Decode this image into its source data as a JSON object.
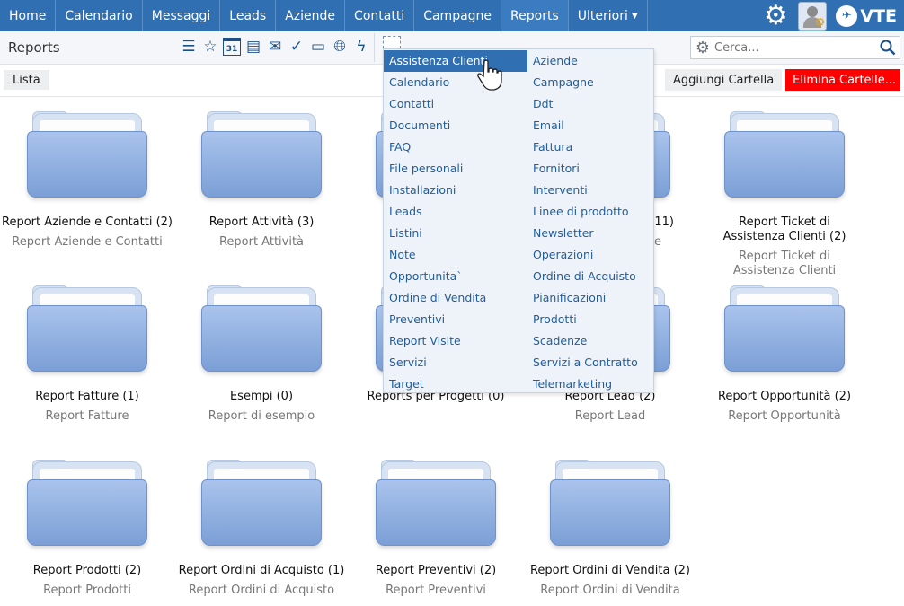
{
  "topnav": {
    "items": [
      {
        "label": "Home"
      },
      {
        "label": "Calendario"
      },
      {
        "label": "Messaggi"
      },
      {
        "label": "Leads"
      },
      {
        "label": "Aziende"
      },
      {
        "label": "Contatti"
      },
      {
        "label": "Campagne"
      },
      {
        "label": "Reports"
      },
      {
        "label": "Ulteriori"
      }
    ],
    "active": "Reports",
    "logo_text": "VTE"
  },
  "subbar": {
    "title": "Reports",
    "toolbar_icons": [
      "list-icon",
      "star-icon",
      "calendar-icon",
      "notes-icon",
      "mail-icon",
      "check-icon",
      "chat-icon",
      "globe-icon",
      "flash-icon"
    ],
    "calendar_day": "31",
    "search_placeholder": "Cerca..."
  },
  "actions": {
    "lista": "Lista",
    "add_folder": "Aggiungi Cartella",
    "delete_folders": "Elimina Cartelle..."
  },
  "folders": [
    {
      "title": "Report Aziende e Contatti (2)",
      "desc": "Report Aziende e Contatti"
    },
    {
      "title": "Report Attività (3)",
      "desc": "Report Attività"
    },
    {
      "title": "",
      "desc": ""
    },
    {
      "title": "(11)",
      "desc": "e"
    },
    {
      "title": "Report Ticket di Assistenza Clienti (2)",
      "desc": "Report Ticket di Assistenza Clienti"
    },
    {
      "title": "Report Fatture (1)",
      "desc": "Report Fatture"
    },
    {
      "title": "Esempi (0)",
      "desc": "Report di esempio"
    },
    {
      "title": "Reports per Progetti (0)",
      "desc": ""
    },
    {
      "title": "Report Lead (2)",
      "desc": "Report Lead"
    },
    {
      "title": "Report Opportunità (2)",
      "desc": "Report Opportunità"
    },
    {
      "title": "Report Prodotti (2)",
      "desc": "Report Prodotti"
    },
    {
      "title": "Report Ordini di Acquisto (1)",
      "desc": "Report Ordini di Acquisto"
    },
    {
      "title": "Report Preventivi (2)",
      "desc": "Report Preventivi"
    },
    {
      "title": "Report Ordini di Vendita (2)",
      "desc": "Report Ordini di Vendita"
    }
  ],
  "dropdown": {
    "left": [
      "Assistenza Clienti",
      "Calendario",
      "Contatti",
      "Documenti",
      "FAQ",
      "File personali",
      "Installazioni",
      "Leads",
      "Listini",
      "Note",
      "Opportunita`",
      "Ordine di Vendita",
      "Preventivi",
      "Report Visite",
      "Servizi",
      "Target"
    ],
    "right": [
      "Aziende",
      "Campagne",
      "Ddt",
      "Email",
      "Fattura",
      "Fornitori",
      "Interventi",
      "Linee di prodotto",
      "Newsletter",
      "Operazioni",
      "Ordine di Acquisto",
      "Pianificazioni",
      "Prodotti",
      "Scadenze",
      "Servizi a Contratto",
      "Telemarketing"
    ],
    "highlighted": "Assistenza Clienti"
  },
  "colors": {
    "nav_bg": "#2f6fb2",
    "link": "#1f5d9c",
    "danger": "#ff0000"
  }
}
